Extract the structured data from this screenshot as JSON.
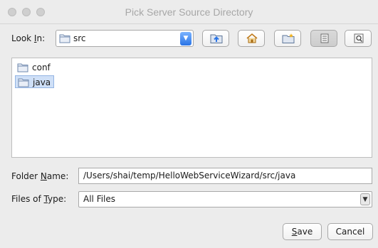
{
  "window": {
    "title": "Pick Server Source Directory"
  },
  "look_in": {
    "label_prefix": "Look ",
    "label_mnemonic": "I",
    "label_suffix": "n:",
    "selected": "src"
  },
  "toolbar": {
    "buttons": [
      {
        "icon": "up-folder-icon",
        "tooltip": "Up One Level"
      },
      {
        "icon": "home-icon",
        "tooltip": "Home"
      },
      {
        "icon": "new-folder-icon",
        "tooltip": "Create New Folder"
      },
      {
        "icon": "list-view-icon",
        "tooltip": "List"
      },
      {
        "icon": "details-view-icon",
        "tooltip": "Details"
      }
    ]
  },
  "files": [
    {
      "name": "conf",
      "selected": false
    },
    {
      "name": "java",
      "selected": true
    }
  ],
  "folder_name": {
    "label_prefix": "Folder ",
    "label_mnemonic": "N",
    "label_suffix": "ame:",
    "value": "/Users/shai/temp/HelloWebServiceWizard/src/java"
  },
  "files_of_type": {
    "label_prefix": "Files of ",
    "label_mnemonic": "T",
    "label_suffix": "ype:",
    "selected": "All Files"
  },
  "actions": {
    "save_mnemonic": "S",
    "save_rest": "ave",
    "cancel": "Cancel"
  },
  "colors": {
    "accent": "#2a74e6",
    "selection": "#cfe0f7"
  }
}
